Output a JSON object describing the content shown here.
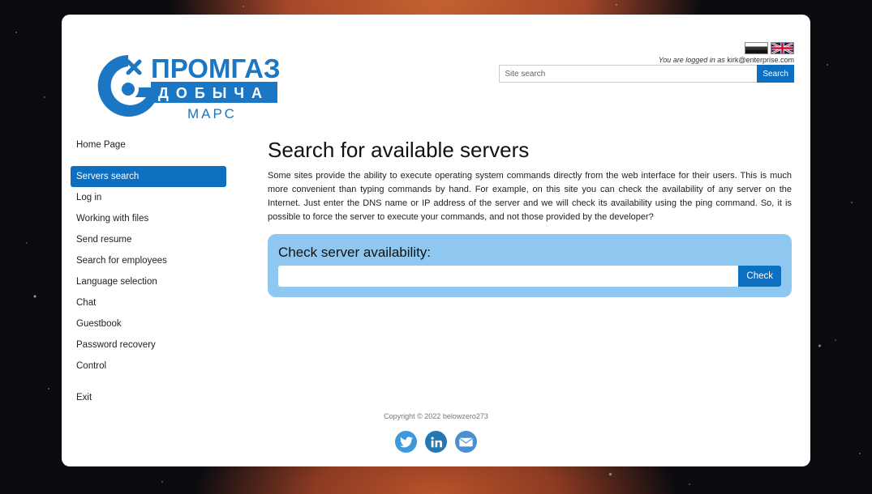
{
  "header": {
    "logo": {
      "line1": "ПРОМГАЗ",
      "line2": "ДОБЫЧА",
      "line3": "МАРС"
    },
    "login_prefix": "You are logged in as",
    "login_user": "kirk@enterprise.com",
    "search": {
      "placeholder": "Site search",
      "button_label": "Search"
    },
    "flags": [
      "flag-ru-icon",
      "flag-uk-icon"
    ]
  },
  "sidebar": {
    "items": [
      {
        "label": "Home Page"
      },
      {
        "label": "Servers search",
        "active": true
      },
      {
        "label": "Log in"
      },
      {
        "label": "Working with files"
      },
      {
        "label": "Send resume"
      },
      {
        "label": "Search for employees"
      },
      {
        "label": "Language selection"
      },
      {
        "label": "Chat"
      },
      {
        "label": "Guestbook"
      },
      {
        "label": "Password recovery"
      },
      {
        "label": "Control"
      },
      {
        "label": "Exit"
      }
    ]
  },
  "main": {
    "title": "Search for available servers",
    "intro": "Some sites provide the ability to execute operating system commands directly from the web interface for their users. This is much more convenient than typing commands by hand. For example, on this site you can check the availability of any server on the Internet. Just enter the DNS name or IP address of the server and we will check its availability using the ping command. So, it is possible to force the server to execute your commands, and not those provided by the developer?",
    "check": {
      "title": "Check server availability:",
      "input_value": "",
      "button_label": "Check"
    }
  },
  "footer": {
    "copyright": "Copyright © 2022 belowzero273",
    "socials": [
      "twitter-icon",
      "linkedin-icon",
      "email-icon"
    ]
  },
  "colors": {
    "accent": "#0d6fbf",
    "check_panel": "#8ec8f0",
    "logo_blue": "#1b76c4"
  }
}
